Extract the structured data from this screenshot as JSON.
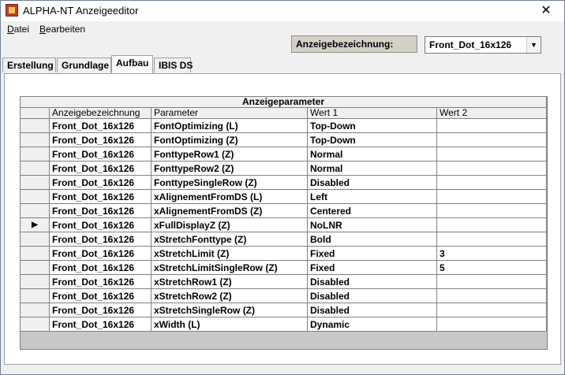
{
  "window": {
    "title": "ALPHA-NT Anzeigeeditor",
    "close_glyph": "✕"
  },
  "menu": [
    {
      "label": "Datei"
    },
    {
      "label": "Bearbeiten"
    }
  ],
  "toolbar": {
    "label": "Anzeigebezeichnung:",
    "combo_value": "Front_Dot_16x126"
  },
  "tabs": [
    {
      "label": "Erstellung",
      "active": false
    },
    {
      "label": "Grundlage",
      "active": false
    },
    {
      "label": "Aufbau",
      "active": true
    },
    {
      "label": "IBIS DS",
      "active": false
    }
  ],
  "grid": {
    "caption": "Anzeigeparameter",
    "columns": [
      "Anzeigebezeichnung",
      "Parameter",
      "Wert 1",
      "Wert 2"
    ],
    "current_row_indicator": "▶",
    "current_row": 7,
    "rows": [
      [
        "Front_Dot_16x126",
        "FontOptimizing (L)",
        "Top-Down",
        ""
      ],
      [
        "Front_Dot_16x126",
        "FontOptimizing (Z)",
        "Top-Down",
        ""
      ],
      [
        "Front_Dot_16x126",
        "FonttypeRow1 (Z)",
        "Normal",
        ""
      ],
      [
        "Front_Dot_16x126",
        "FonttypeRow2 (Z)",
        "Normal",
        ""
      ],
      [
        "Front_Dot_16x126",
        "FonttypeSingleRow (Z)",
        "Disabled",
        ""
      ],
      [
        "Front_Dot_16x126",
        "xAlignementFromDS (L)",
        "Left",
        ""
      ],
      [
        "Front_Dot_16x126",
        "xAlignementFromDS (Z)",
        "Centered",
        ""
      ],
      [
        "Front_Dot_16x126",
        "xFullDisplayZ (Z)",
        "NoLNR",
        ""
      ],
      [
        "Front_Dot_16x126",
        "xStretchFonttype (Z)",
        "Bold",
        ""
      ],
      [
        "Front_Dot_16x126",
        "xStretchLimit (Z)",
        "Fixed",
        "3"
      ],
      [
        "Front_Dot_16x126",
        "xStretchLimitSingleRow (Z)",
        "Fixed",
        "5"
      ],
      [
        "Front_Dot_16x126",
        "xStretchRow1 (Z)",
        "Disabled",
        ""
      ],
      [
        "Front_Dot_16x126",
        "xStretchRow2 (Z)",
        "Disabled",
        ""
      ],
      [
        "Front_Dot_16x126",
        "xStretchSingleRow (Z)",
        "Disabled",
        ""
      ],
      [
        "Front_Dot_16x126",
        "xWidth (L)",
        "Dynamic",
        ""
      ]
    ]
  }
}
